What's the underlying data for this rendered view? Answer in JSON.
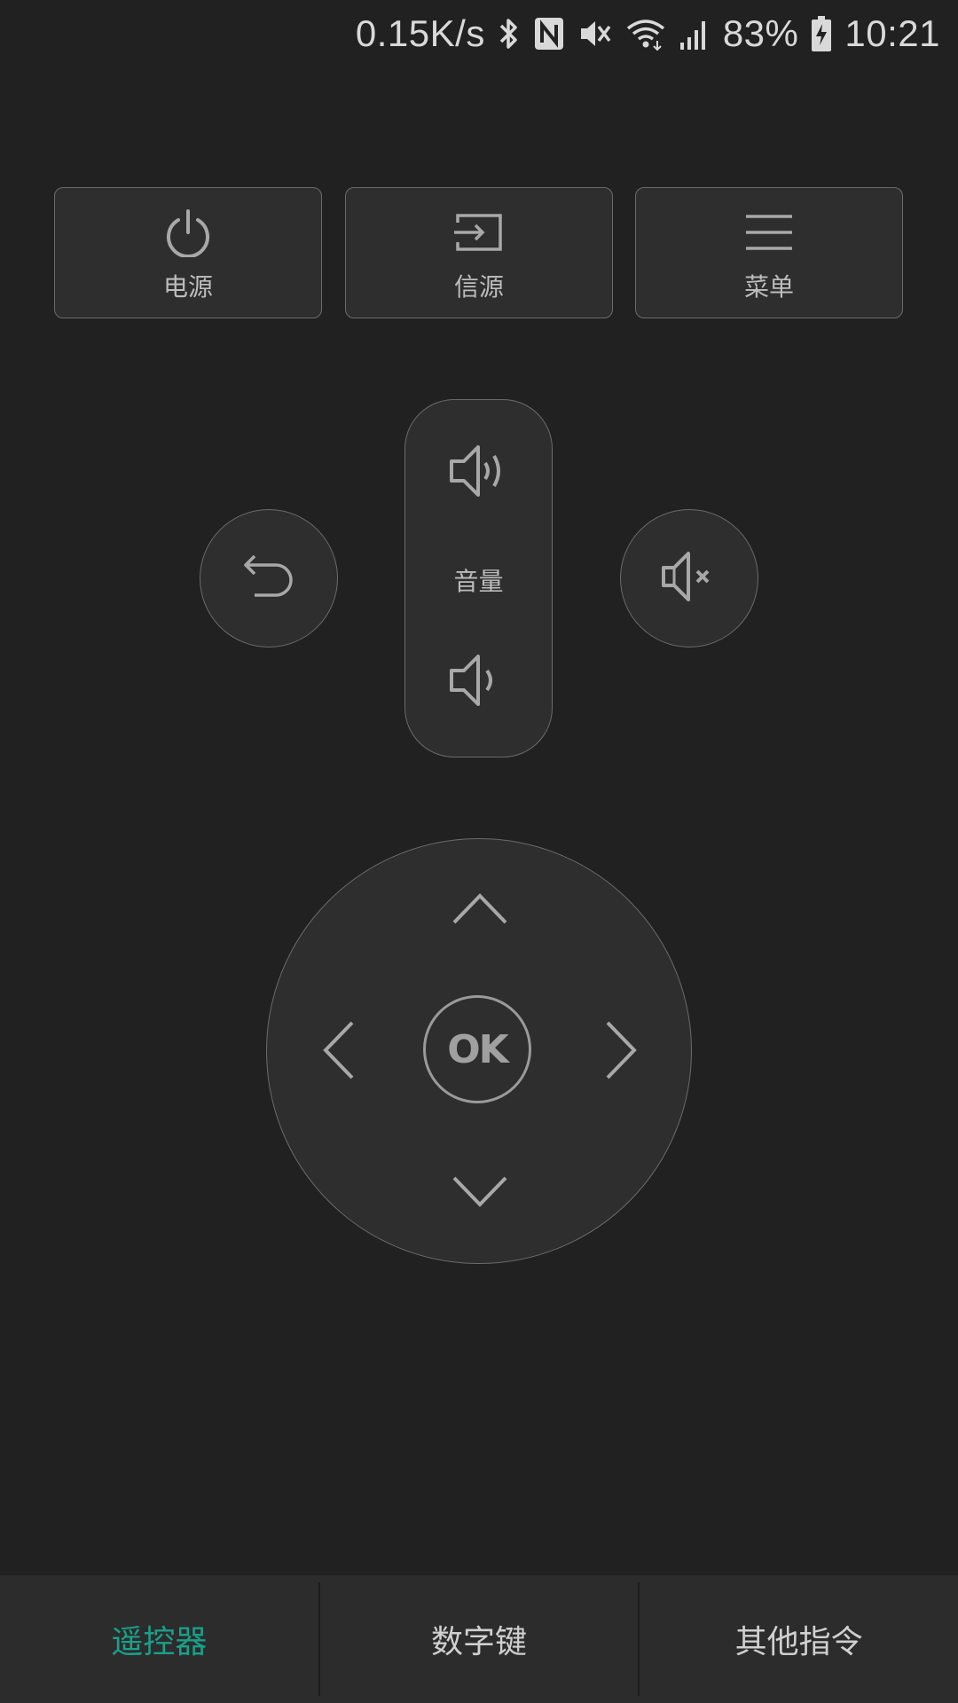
{
  "status_bar": {
    "net_speed": "0.15K/s",
    "battery_percent": "83%",
    "time": "10:21",
    "icons": [
      "bluetooth-icon",
      "nfc-icon",
      "mute-icon",
      "wifi-icon",
      "signal-icon",
      "battery-charging-icon"
    ]
  },
  "top_buttons": {
    "power_label": "电源",
    "source_label": "信源",
    "menu_label": "菜单"
  },
  "volume": {
    "label": "音量"
  },
  "dpad": {
    "ok_label": "OK"
  },
  "bottom_nav": {
    "tabs": [
      {
        "label": "遥控器",
        "active": true
      },
      {
        "label": "数字键",
        "active": false
      },
      {
        "label": "其他指令",
        "active": false
      }
    ],
    "active_color": "#1aa08a"
  }
}
